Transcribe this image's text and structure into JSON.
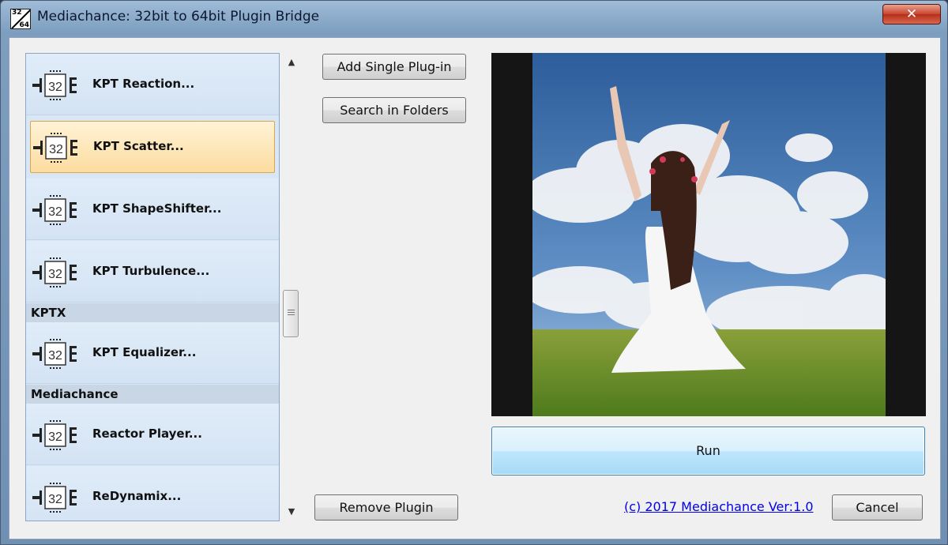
{
  "window": {
    "title": "Mediachance: 32bit to 64bit Plugin Bridge",
    "icon_top": "32",
    "icon_bottom": "64",
    "close_glyph": "✕"
  },
  "plugin_list": {
    "items": [
      {
        "label": "KPT Reaction...",
        "chip": "32",
        "selected": false
      },
      {
        "label": "KPT Scatter...",
        "chip": "32",
        "selected": true
      },
      {
        "label": "KPT ShapeShifter...",
        "chip": "32",
        "selected": false
      },
      {
        "label": "KPT Turbulence...",
        "chip": "32",
        "selected": false
      }
    ],
    "groups": [
      {
        "header": "KPTX",
        "items": [
          {
            "label": "KPT Equalizer...",
            "chip": "32"
          }
        ]
      },
      {
        "header": "Mediachance",
        "items": [
          {
            "label": "Reactor Player...",
            "chip": "32"
          },
          {
            "label": "ReDynamix...",
            "chip": "32"
          }
        ]
      }
    ],
    "scroll_up": "▲",
    "scroll_down": "▼"
  },
  "buttons": {
    "add_single": "Add Single Plug-in",
    "search_folders": "Search in Folders",
    "remove": "Remove Plugin",
    "run": "Run",
    "cancel": "Cancel"
  },
  "footer": {
    "link": "(c) 2017 Mediachance Ver:1.0"
  },
  "colors": {
    "selection_fill": "#fcdca0",
    "list_fill": "#d8e6f5",
    "run_accent": "#3c7fb1",
    "link": "#0000ee"
  }
}
